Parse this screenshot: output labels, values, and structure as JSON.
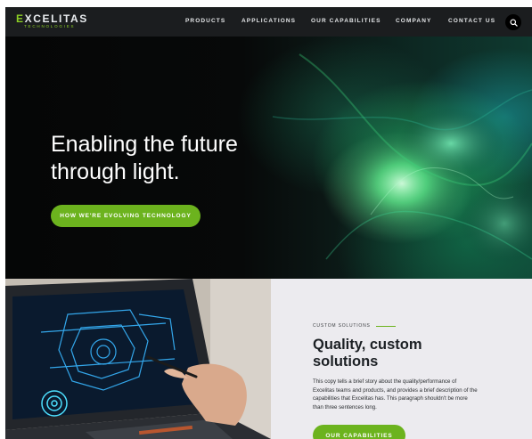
{
  "brand": {
    "logo_text": "EXCELITAS",
    "logo_sub": "TECHNOLOGIES",
    "accent_color": "#6cb31e",
    "nav_bg_color": "#1b1d1f"
  },
  "nav": {
    "items": [
      {
        "label": "PRODUCTS"
      },
      {
        "label": "APPLICATIONS"
      },
      {
        "label": "OUR CAPABILITIES"
      },
      {
        "label": "COMPANY"
      },
      {
        "label": "CONTACT US"
      }
    ],
    "search_icon": "search-icon"
  },
  "hero": {
    "title_line1": "Enabling the future",
    "title_line2": "through light.",
    "cta_label": "HOW WE'RE EVOLVING TECHNOLOGY"
  },
  "solutions": {
    "eyebrow": "CUSTOM SOLUTIONS",
    "title_line1": "Quality, custom",
    "title_line2": "solutions",
    "body_lines": [
      "This copy tells a brief story about the quality/performance of",
      "Excelitas teams and products, and provides a brief description of the",
      "capabilities that Excelitas has. This paragraph shouldn't be more",
      "than three sentences long."
    ],
    "cta_label": "OUR CAPABILITIES",
    "panel_bg_color": "#ecebef"
  }
}
